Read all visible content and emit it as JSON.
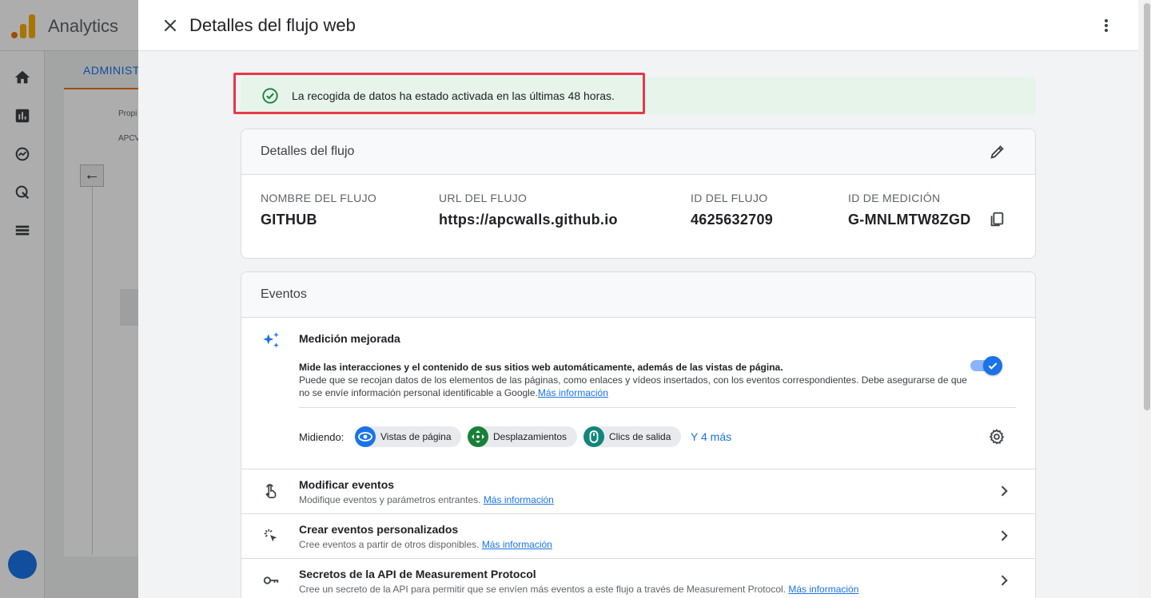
{
  "background": {
    "app_title": "Analytics",
    "admin_tab": "ADMINISTR",
    "property_label": "Propi",
    "property_value": "APCV"
  },
  "drawer": {
    "title": "Detalles del flujo web"
  },
  "status": {
    "text": "La recogida de datos ha estado activada en las últimas 48 horas.",
    "color": "#e6f4ea",
    "highlight_color": "#e63946"
  },
  "stream_details": {
    "heading": "Detalles del flujo",
    "fields": [
      {
        "label": "NOMBRE DEL FLUJO",
        "value": "GITHUB"
      },
      {
        "label": "URL DEL FLUJO",
        "value": "https://apcwalls.github.io"
      },
      {
        "label": "ID DEL FLUJO",
        "value": "4625632709"
      },
      {
        "label": "ID DE MEDICIÓN",
        "value": "G-MNLMTW8ZGD"
      }
    ]
  },
  "events": {
    "heading": "Eventos",
    "enhanced": {
      "title": "Medición mejorada",
      "desc_bold": "Mide las interacciones y el contenido de sus sitios web automáticamente, además de las vistas de página.",
      "desc_rest": "Puede que se recojan datos de los elementos de las páginas, como enlaces y vídeos insertados, con los eventos correspondientes. Debe asegurarse de que no se envíe información personal identificable a Google.",
      "link": "Más información",
      "toggle_on": true,
      "measuring_label": "Midiendo:",
      "chips": [
        {
          "label": "Vistas de página",
          "icon": "eye-icon",
          "color": "#1a73e8"
        },
        {
          "label": "Desplazamientos",
          "icon": "scroll-icon",
          "color": "#188038"
        },
        {
          "label": "Clics de salida",
          "icon": "mouse-icon",
          "color": "#12867a"
        }
      ],
      "more": "Y 4 más"
    },
    "rows": [
      {
        "title": "Modificar eventos",
        "sub": "Modifique eventos y parámetros entrantes.",
        "link": "Más información",
        "icon": "touch-icon"
      },
      {
        "title": "Crear eventos personalizados",
        "sub": "Cree eventos a partir de otros disponibles.",
        "link": "Más información",
        "icon": "click-sparkle-icon"
      },
      {
        "title": "Secretos de la API de Measurement Protocol",
        "sub": "Cree un secreto de la API para permitir que se envíen más eventos a este flujo a través de Measurement Protocol.",
        "link": "Más información",
        "icon": "key-icon"
      }
    ]
  }
}
